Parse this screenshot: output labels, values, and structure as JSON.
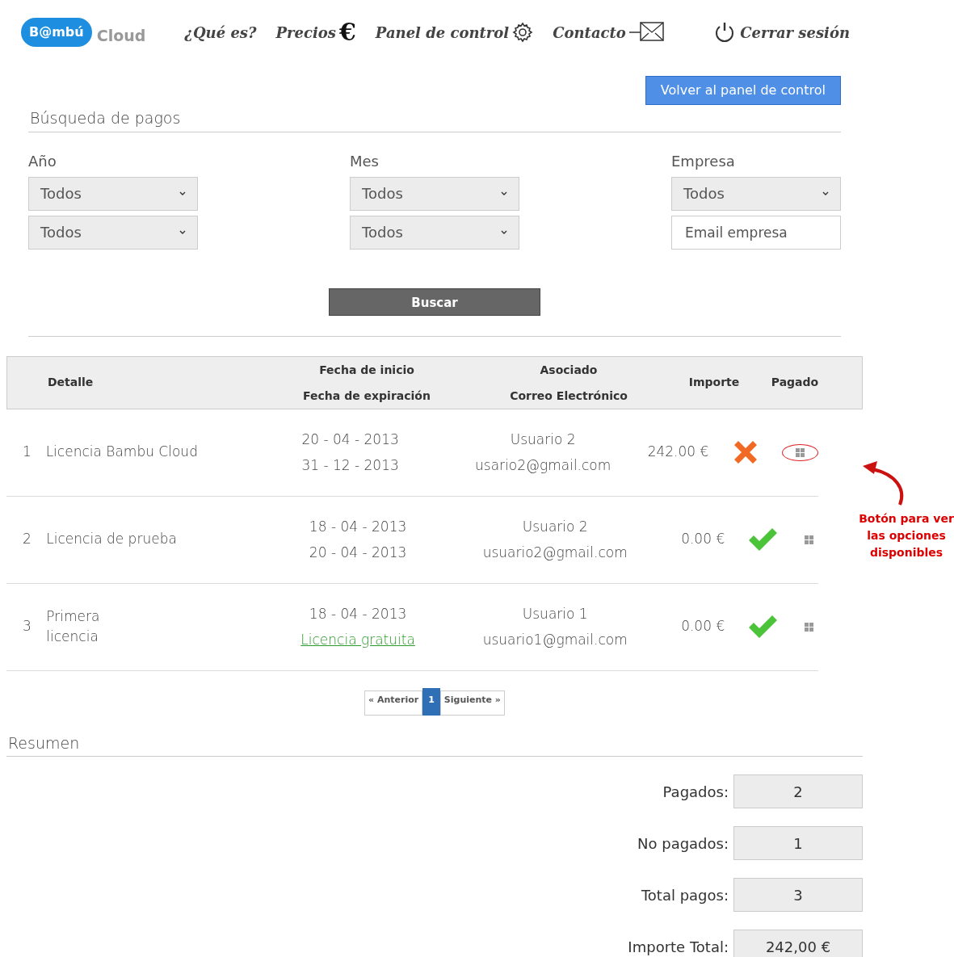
{
  "logo": {
    "brand": "B@mbú",
    "product": "Cloud"
  },
  "nav": [
    {
      "label": "¿Qué es?",
      "kind": "text"
    },
    {
      "label": "Precios",
      "kind": "euro",
      "glyph": "€"
    },
    {
      "label": "Panel de control",
      "kind": "gear"
    },
    {
      "label": "Contacto",
      "kind": "mail"
    }
  ],
  "logout": {
    "label": "Cerrar sesión"
  },
  "back_button": "Volver al panel de control",
  "search": {
    "title": "Búsqueda de pagos",
    "filters": [
      {
        "label": "Año",
        "fields": [
          {
            "kind": "select",
            "value": "Todos"
          },
          {
            "kind": "select",
            "value": "Todos"
          }
        ]
      },
      {
        "label": "Mes",
        "fields": [
          {
            "kind": "select",
            "value": "Todos"
          },
          {
            "kind": "select",
            "value": "Todos"
          }
        ]
      },
      {
        "label": "Empresa",
        "fields": [
          {
            "kind": "select",
            "value": "Todos"
          },
          {
            "kind": "input",
            "placeholder": "Email empresa"
          }
        ]
      }
    ],
    "button": "Buscar"
  },
  "table": {
    "columns": [
      [
        "Detalle"
      ],
      [
        "Fecha de inicio",
        "Fecha de expiración"
      ],
      [
        "Asociado",
        "Correo Electrónico"
      ],
      [
        "Importe"
      ],
      [
        "Pagado"
      ]
    ],
    "rows": [
      {
        "index": "1",
        "detail": "Licencia Bambu Cloud",
        "start": "20 - 04 - 2013",
        "end": {
          "kind": "text",
          "text": "31 - 12 - 2013"
        },
        "user": "Usuario 2",
        "email": "usario2@gmail.com",
        "amount": "242.00 €",
        "paid": false,
        "highlighted": true
      },
      {
        "index": "2",
        "detail": "Licencia de prueba",
        "start": "18 - 04 - 2013",
        "end": {
          "kind": "text",
          "text": "20 - 04 - 2013"
        },
        "user": "Usuario 2",
        "email": "usuario2@gmail.com",
        "amount": "0.00 €",
        "paid": true,
        "highlighted": false
      },
      {
        "index": "3",
        "detail": "Primera licencia",
        "start": "18 - 04 - 2013",
        "end": {
          "kind": "link",
          "text": "Licencia gratuita"
        },
        "user": "Usuario 1",
        "email": "usuario1@gmail.com",
        "amount": "0.00 €",
        "paid": true,
        "highlighted": false
      }
    ]
  },
  "annotation": "Botón para ver las opciones disponibles",
  "pagination": {
    "prev": "« Anterior",
    "pages": [
      {
        "label": "1",
        "selected": true
      }
    ],
    "next": "Siguiente »"
  },
  "summary": {
    "title": "Resumen",
    "items": [
      {
        "label": "Pagados:",
        "value": "2"
      },
      {
        "label": "No pagados:",
        "value": "1"
      },
      {
        "label": "Total pagos:",
        "value": "3"
      },
      {
        "label": "Importe Total:",
        "value": "242,00 €"
      }
    ]
  }
}
